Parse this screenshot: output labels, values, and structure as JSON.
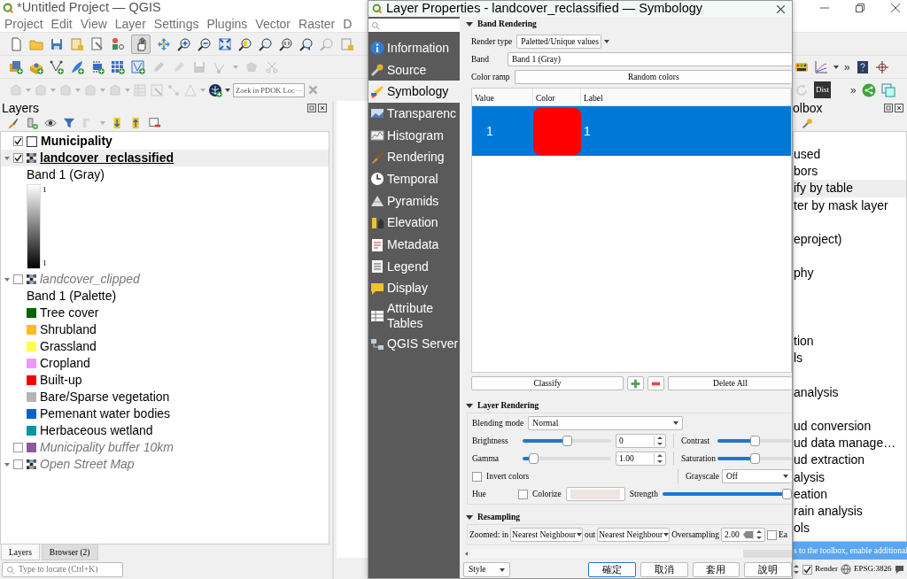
{
  "window": {
    "title": "*Untitled Project — QGIS",
    "menu": [
      "Project",
      "Edit",
      "View",
      "Layer",
      "Settings",
      "Plugins",
      "Vector",
      "Raster",
      "D"
    ]
  },
  "toolbars": {
    "locator_placeholder": "Zoek in PDOK Loc···",
    "row2_overflow": "»",
    "row3_overflow": "»",
    "dist": "Dist"
  },
  "layers_panel": {
    "title": "Layers",
    "tree": [
      {
        "kind": "vector",
        "label": "Municipality",
        "checked": true,
        "current": false
      },
      {
        "kind": "raster",
        "label": "landcover_reclassified",
        "checked": true,
        "current": true,
        "expanded": true,
        "children": [
          {
            "kind": "label",
            "label": "Band 1 (Gray)"
          },
          {
            "kind": "ramp",
            "max": "1",
            "min": "1"
          }
        ]
      },
      {
        "kind": "raster",
        "label": "landcover_clipped",
        "checked": false,
        "current": false,
        "expanded": true,
        "children": [
          {
            "kind": "label",
            "label": "Band 1 (Palette)"
          },
          {
            "kind": "class",
            "label": "Tree cover",
            "color": "#006400"
          },
          {
            "kind": "class",
            "label": "Shrubland",
            "color": "#ffbb22"
          },
          {
            "kind": "class",
            "label": "Grassland",
            "color": "#ffff4c"
          },
          {
            "kind": "class",
            "label": "Cropland",
            "color": "#f096ff"
          },
          {
            "kind": "class",
            "label": "Built-up",
            "color": "#fa0000"
          },
          {
            "kind": "class",
            "label": "Bare/Sparse vegetation",
            "color": "#b4b4b4"
          },
          {
            "kind": "class",
            "label": "Pemenant water bodies",
            "color": "#0064c8"
          },
          {
            "kind": "class",
            "label": "Herbaceous wetland",
            "color": "#0096a0"
          }
        ]
      },
      {
        "kind": "fill",
        "label": "Municipality buffer 10km",
        "color": "#8c5a9c",
        "checked": false,
        "current": false
      },
      {
        "kind": "raster",
        "label": "Open Street Map",
        "checked": false,
        "current": false,
        "expanded": true
      }
    ],
    "tabs": [
      {
        "label": "Layers",
        "selected": true
      },
      {
        "label": "Browser (2)",
        "selected": false
      }
    ],
    "locate": {
      "placeholder": "Type to locate (Ctrl+K)"
    }
  },
  "toolbox_panel": {
    "title": "olbox",
    "items": [
      {
        "kind": "text",
        "label": "used",
        "selected": false
      },
      {
        "kind": "text",
        "label": "bors",
        "selected": false
      },
      {
        "kind": "text",
        "label": "ify by table",
        "selected": true
      },
      {
        "kind": "text",
        "label": "ter by mask layer",
        "selected": false
      },
      {
        "kind": "covered",
        "selected": false
      },
      {
        "kind": "text",
        "label": "eproject)",
        "selected": false
      },
      {
        "kind": "covered",
        "selected": false
      },
      {
        "kind": "text",
        "label": "phy",
        "selected": false
      },
      {
        "kind": "covered",
        "selected": false
      },
      {
        "kind": "covered",
        "selected": false
      },
      {
        "kind": "covered",
        "selected": false
      },
      {
        "kind": "text",
        "label": "tion",
        "selected": false
      },
      {
        "kind": "text",
        "label": "ls",
        "selected": false
      },
      {
        "kind": "covered",
        "selected": false
      },
      {
        "kind": "text",
        "label": "analysis",
        "selected": false
      },
      {
        "kind": "covered",
        "selected": false
      },
      {
        "kind": "text",
        "label": "ud conversion",
        "selected": false
      },
      {
        "kind": "text",
        "label": "ud data manage…",
        "selected": false
      },
      {
        "kind": "text",
        "label": "ud extraction",
        "selected": false
      },
      {
        "kind": "text",
        "label": "alysis",
        "selected": false
      },
      {
        "kind": "text",
        "label": "eation",
        "selected": false
      },
      {
        "kind": "text",
        "label": "rain analysis",
        "selected": false
      },
      {
        "kind": "text",
        "label": "ols",
        "selected": false
      }
    ]
  },
  "message_bar": {
    "text": "s to the toolbox, ",
    "link": "enable additional"
  },
  "status_bar": {
    "render": {
      "label": "Render",
      "checked": true
    },
    "crs": "EPSG:3826"
  },
  "dialog": {
    "title": "Layer Properties - landcover_reclassified — Symbology",
    "nav": [
      {
        "label": "Information",
        "selected": false
      },
      {
        "label": "Source",
        "selected": false
      },
      {
        "label": "Symbology",
        "selected": true
      },
      {
        "label": "Transparenc",
        "selected": false
      },
      {
        "label": "Histogram",
        "selected": false
      },
      {
        "label": "Rendering",
        "selected": false
      },
      {
        "label": "Temporal",
        "selected": false
      },
      {
        "label": "Pyramids",
        "selected": false
      },
      {
        "label": "Elevation",
        "selected": false
      },
      {
        "label": "Metadata",
        "selected": false
      },
      {
        "label": "Legend",
        "selected": false
      },
      {
        "label": "Display",
        "selected": false
      },
      {
        "label": "Attribute Tables",
        "selected": false
      },
      {
        "label": "QGIS Server",
        "selected": false
      }
    ],
    "band_rendering": {
      "title": "Band Rendering",
      "expanded": true,
      "render_type_label": "Render type",
      "render_type": "Paletted/Unique values",
      "band_label": "Band",
      "band": "Band 1 (Gray)",
      "color_ramp_label": "Color ramp",
      "color_ramp": "Random colors",
      "columns": [
        "Value",
        "Color",
        "Label"
      ],
      "rows": [
        {
          "value": "1",
          "color": "#ff0000",
          "label": "1",
          "selected": true
        }
      ],
      "classify": "Classify",
      "delete_all": "Delete All"
    },
    "layer_rendering": {
      "title": "Layer Rendering",
      "expanded": true,
      "blending_label": "Blending mode",
      "blending": "Normal",
      "brightness": {
        "label": "Brightness",
        "level": 0.5,
        "value": "0"
      },
      "contrast": {
        "label": "Contrast",
        "level": 0.5
      },
      "gamma": {
        "label": "Gamma",
        "level": 0.08,
        "value": "1.00"
      },
      "saturation": {
        "label": "Saturation",
        "level": 0.5
      },
      "invert": {
        "label": "Invert colors",
        "checked": false
      },
      "grayscale_label": "Grayscale",
      "grayscale": "Off",
      "hue_label": "Hue",
      "colorize": {
        "label": "Colorize",
        "checked": false
      },
      "strength": {
        "label": "Strength",
        "level": 1
      }
    },
    "resampling": {
      "title": "Resampling",
      "expanded": true,
      "zoomed_in_label": "Zoomed: in",
      "zoomed_in": "Nearest Neighbour",
      "out_label": "out",
      "zoomed_out": "Nearest Neighbour",
      "oversampling_label": "Oversampling",
      "oversampling": "2.00",
      "early": {
        "label": "Ea",
        "checked": false
      }
    },
    "footer": {
      "style": "Style",
      "buttons": [
        {
          "label": "確定",
          "default": true
        },
        {
          "label": "取消",
          "default": false
        },
        {
          "label": "套用",
          "default": false
        },
        {
          "label": "說明",
          "default": false
        }
      ]
    }
  }
}
